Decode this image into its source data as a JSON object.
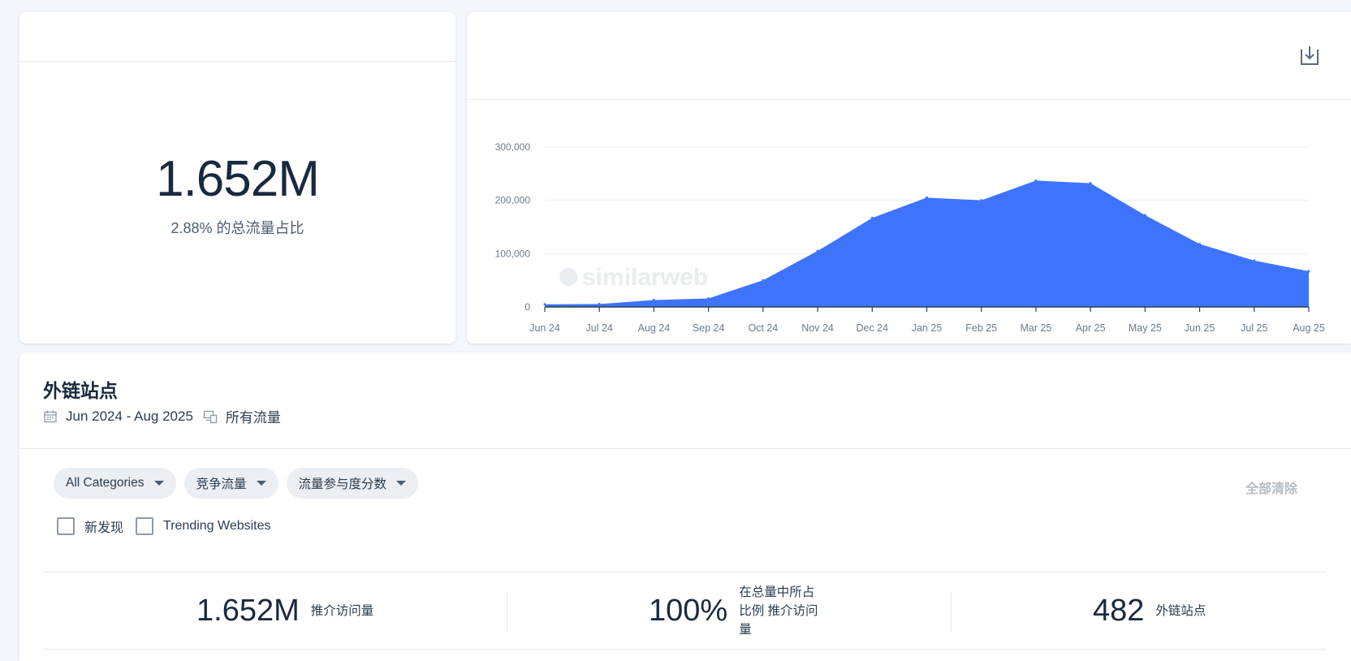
{
  "total": {
    "value": "1.652M",
    "share": "2.88% 的总流量占比"
  },
  "chart_data": {
    "type": "area",
    "categories": [
      "Jun 24",
      "Jul 24",
      "Aug 24",
      "Sep 24",
      "Oct 24",
      "Nov 24",
      "Dec 24",
      "Jan 25",
      "Feb 25",
      "Mar 25",
      "Apr 25",
      "May 25",
      "Jun 25",
      "Jul 25",
      "Aug 25"
    ],
    "values": [
      5000,
      5500,
      13000,
      16000,
      50000,
      105000,
      167000,
      205000,
      200000,
      237000,
      232000,
      172000,
      118000,
      87000,
      67000
    ],
    "y_ticks": [
      "0",
      "100,000",
      "200,000",
      "300,000"
    ],
    "ylim": [
      0,
      300000
    ],
    "grid": true,
    "color": "#3e74fd",
    "watermark": "similarweb"
  },
  "section": {
    "title": "外链站点",
    "date_range": "Jun 2024 - Aug 2025",
    "traffic_type": "所有流量"
  },
  "filters": {
    "categories": "All Categories",
    "competitive": "竞争流量",
    "engagement": "流量参与度分数",
    "clear_all": "全部清除",
    "checkbox_new": "新发现",
    "checkbox_trending": "Trending Websites"
  },
  "metrics": {
    "referral_visits_value": "1.652M",
    "referral_visits_label": "推介访问量",
    "share_value": "100%",
    "share_label_1": "在总量中所占",
    "share_label_2": "比例 推介访问",
    "share_label_3": "量",
    "sites_value": "482",
    "sites_label": "外链站点"
  }
}
